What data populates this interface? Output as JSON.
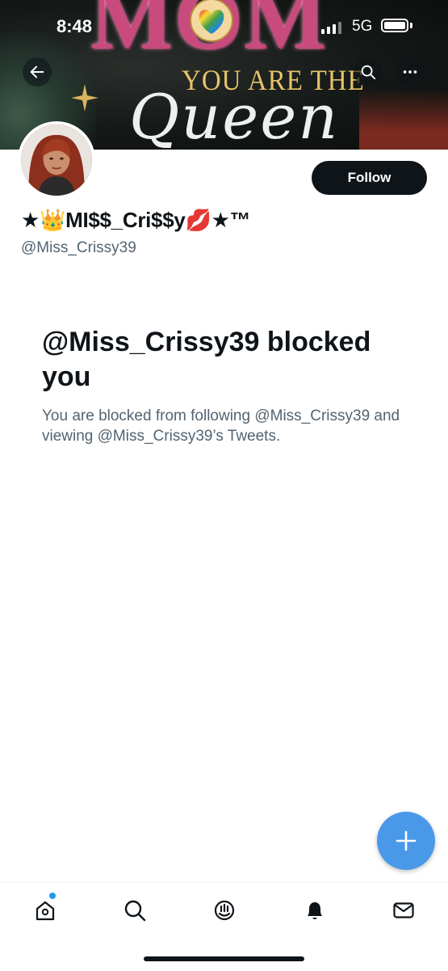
{
  "status_bar": {
    "time": "8:48",
    "network": "5G"
  },
  "banner": {
    "word_top": "MOM",
    "line_middle": "YOU ARE THE",
    "line_bottom": "Queen"
  },
  "profile": {
    "display_name": "★👑MI$$_Cri$$y💋★™",
    "handle": "@Miss_Crissy39",
    "follow_label": "Follow"
  },
  "blocked": {
    "title": "@Miss_Crissy39 blocked you",
    "message": "You are blocked from following @Miss_Crissy39 and viewing @Miss_Crissy39’s Tweets."
  },
  "icons": {
    "back": "arrow-left-icon",
    "search": "search-icon",
    "more": "more-icon",
    "compose": "plus-icon",
    "tabs": [
      "home-icon",
      "search-icon",
      "spaces-icon",
      "notifications-icon",
      "messages-icon"
    ]
  },
  "colors": {
    "accent": "#1d9bf0",
    "fab": "#4a99e9",
    "text_primary": "#0f1419",
    "text_secondary": "#536471"
  }
}
